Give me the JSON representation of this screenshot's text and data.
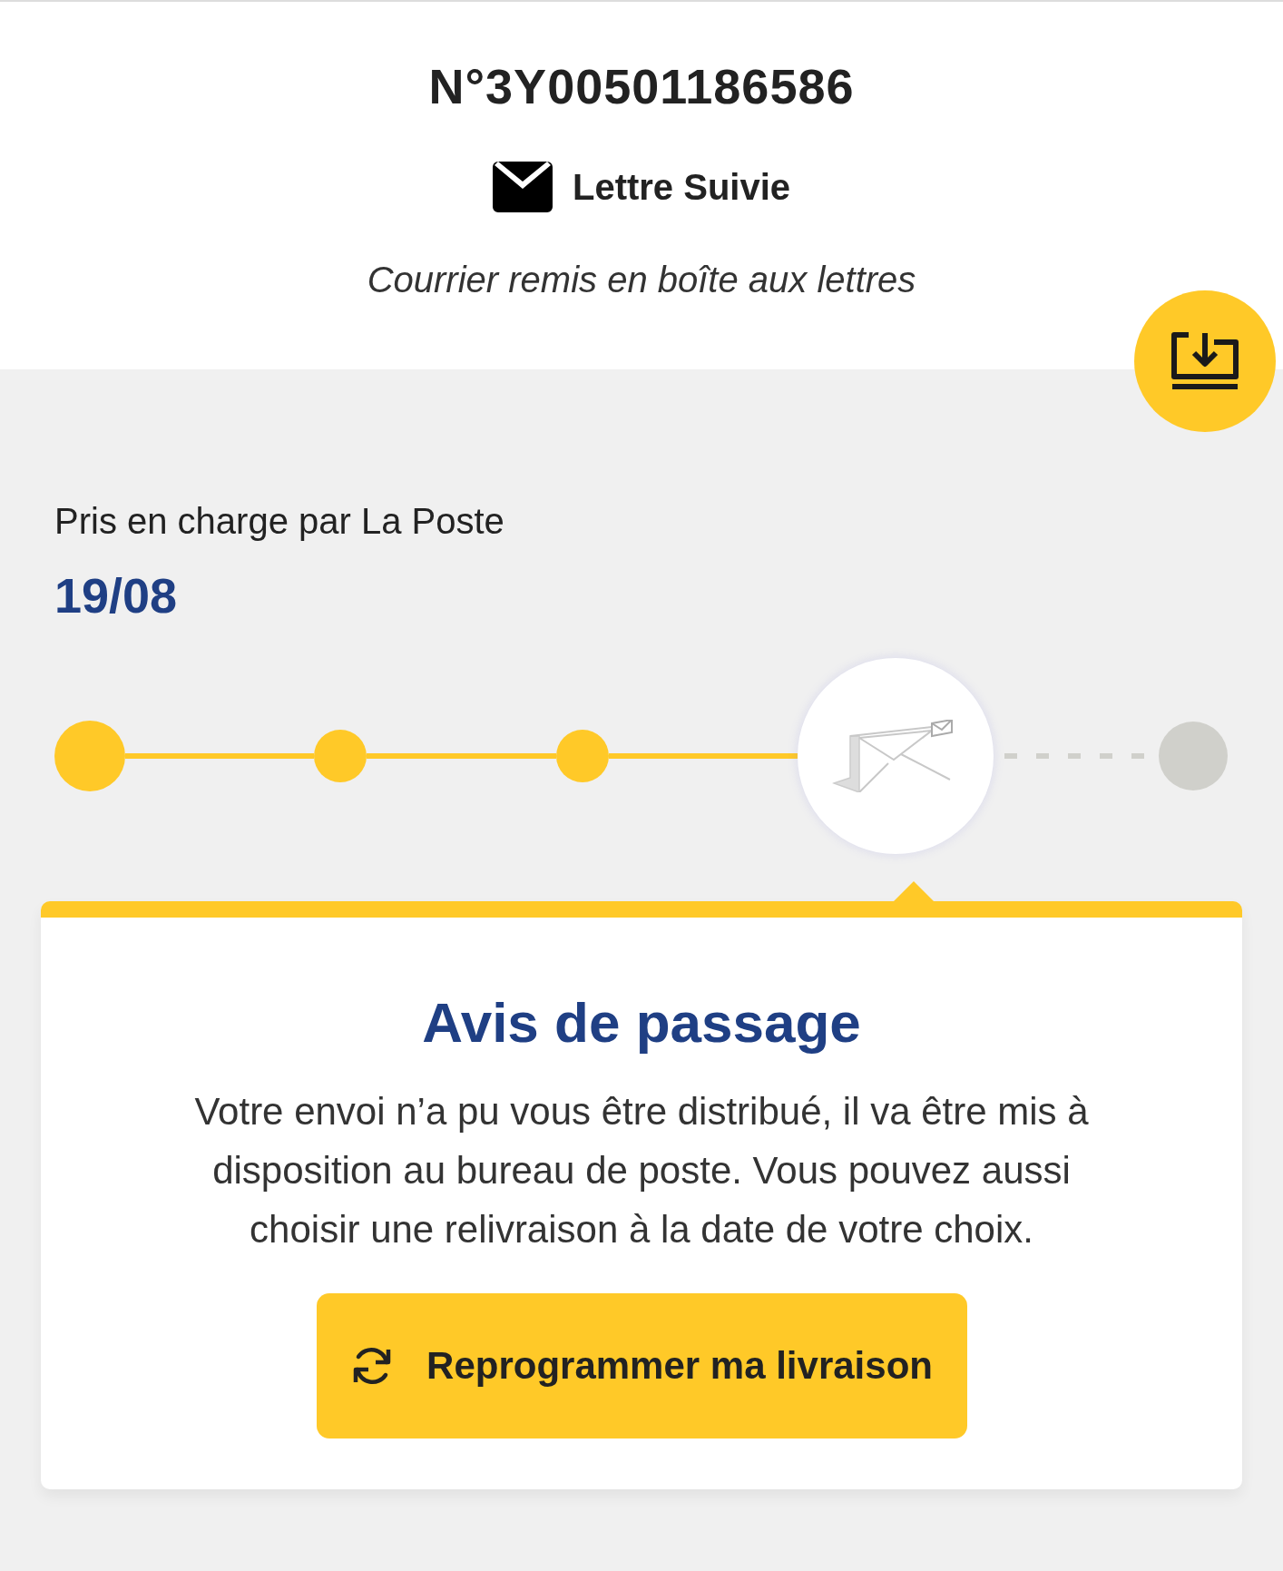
{
  "tracking_number": "N°3Y00501186586",
  "product": {
    "name": "Lettre Suivie"
  },
  "delivery_mode": "Courrier remis en boîte aux lettres",
  "last_event": {
    "label": "Pris en charge par La Poste",
    "date": "19/08"
  },
  "steps": [
    {
      "kind": "start"
    },
    {
      "kind": "done"
    },
    {
      "kind": "done"
    },
    {
      "kind": "current"
    },
    {
      "kind": "pending"
    }
  ],
  "status_card": {
    "title": "Avis de passage",
    "message": "Votre envoi n’a pu vous être distribué, il va être mis à disposition au bureau de poste. Vous pouvez aussi choisir une relivraison à la date de votre choix.",
    "button": "Reprogrammer ma livraison"
  }
}
